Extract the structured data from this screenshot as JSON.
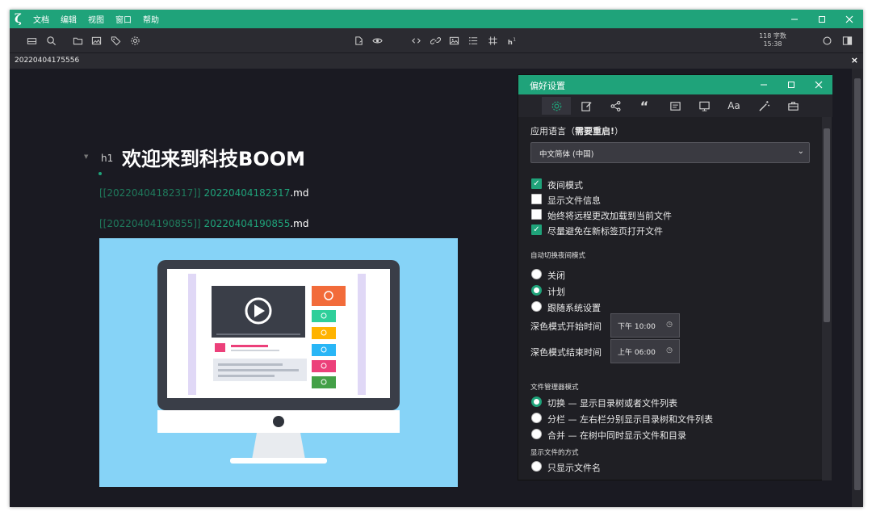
{
  "app": {
    "menu": [
      "文档",
      "编辑",
      "视图",
      "窗口",
      "帮助"
    ],
    "logo": "ζ"
  },
  "toolbar": {
    "word_count": "118 字数",
    "time": "15:38"
  },
  "tab": {
    "title": "20220404175556",
    "close": "×"
  },
  "document": {
    "heading_tag": "h1",
    "heading": "欢迎来到科技BOOM",
    "links": [
      {
        "bracket": "[[20220404182317]]",
        "link": " 20220404182317",
        "ext": ".md"
      },
      {
        "bracket": "[[20220404190855]]",
        "link": " 20220404190855",
        "ext": ".md"
      }
    ]
  },
  "dialog": {
    "title": "偏好设置",
    "tab_font_label": "Aa",
    "tab_quote_label": "“",
    "language_label_prefix": "应用语言（",
    "language_label_bold": "需要重启!",
    "language_label_suffix": "）",
    "language_value": "中文简体 (中国)",
    "checkboxes": [
      {
        "label": "夜间模式",
        "checked": true
      },
      {
        "label": "显示文件信息",
        "checked": false
      },
      {
        "label": "始终将远程更改加载到当前文件",
        "checked": false
      },
      {
        "label": "尽量避免在新标签页打开文件",
        "checked": true
      }
    ],
    "auto_night_title": "自动切换夜间模式",
    "auto_night_options": [
      {
        "label": "关闭",
        "selected": false
      },
      {
        "label": "计划",
        "selected": true
      },
      {
        "label": "跟随系统设置",
        "selected": false
      }
    ],
    "dark_start_label": "深色模式开始时间",
    "dark_start_value": "下午 10:00",
    "dark_end_label": "深色模式结束时间",
    "dark_end_value": "上午 06:00",
    "file_manager_title": "文件管理器模式",
    "file_manager_options": [
      {
        "label": "切换 — 显示目录树或者文件列表",
        "selected": true
      },
      {
        "label": "分栏 — 左右栏分别显示目录树和文件列表",
        "selected": false
      },
      {
        "label": "合并 — 在树中同时显示文件和目录",
        "selected": false
      }
    ],
    "display_files_title": "显示文件的方式",
    "display_files_options": [
      {
        "label": "只显示文件名",
        "selected": false
      }
    ]
  },
  "colors": {
    "accent": "#1fa37a",
    "editor_bg": "#1a1a22",
    "panel_bg": "#1f1f24",
    "hero_bg": "#86d3f7"
  }
}
